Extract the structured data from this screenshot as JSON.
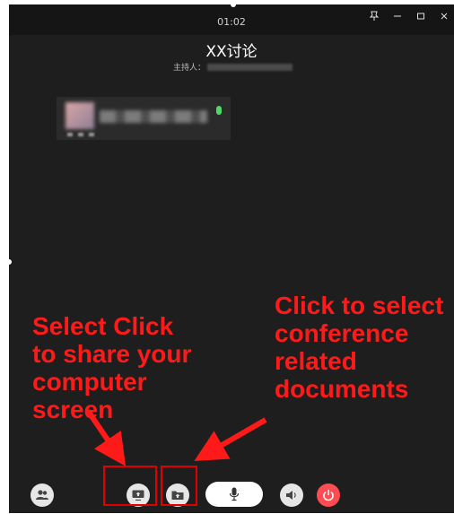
{
  "window": {
    "timer": "01:02",
    "title": "XX讨论",
    "host_label": "主持人："
  },
  "annotations": {
    "share_screen": "Select Click to share your computer screen",
    "documents": "Click to select conference related documents"
  },
  "toolbar": {
    "buttons": [
      "participants-icon",
      "share-screen-icon",
      "documents-icon",
      "microphone-icon",
      "speaker-icon",
      "hang-up-icon"
    ]
  },
  "colors": {
    "window_bg": "#1e1e1e",
    "annotation": "#ff1a1a",
    "hangup": "#ff4b52",
    "mic_active": "#4cd964"
  }
}
